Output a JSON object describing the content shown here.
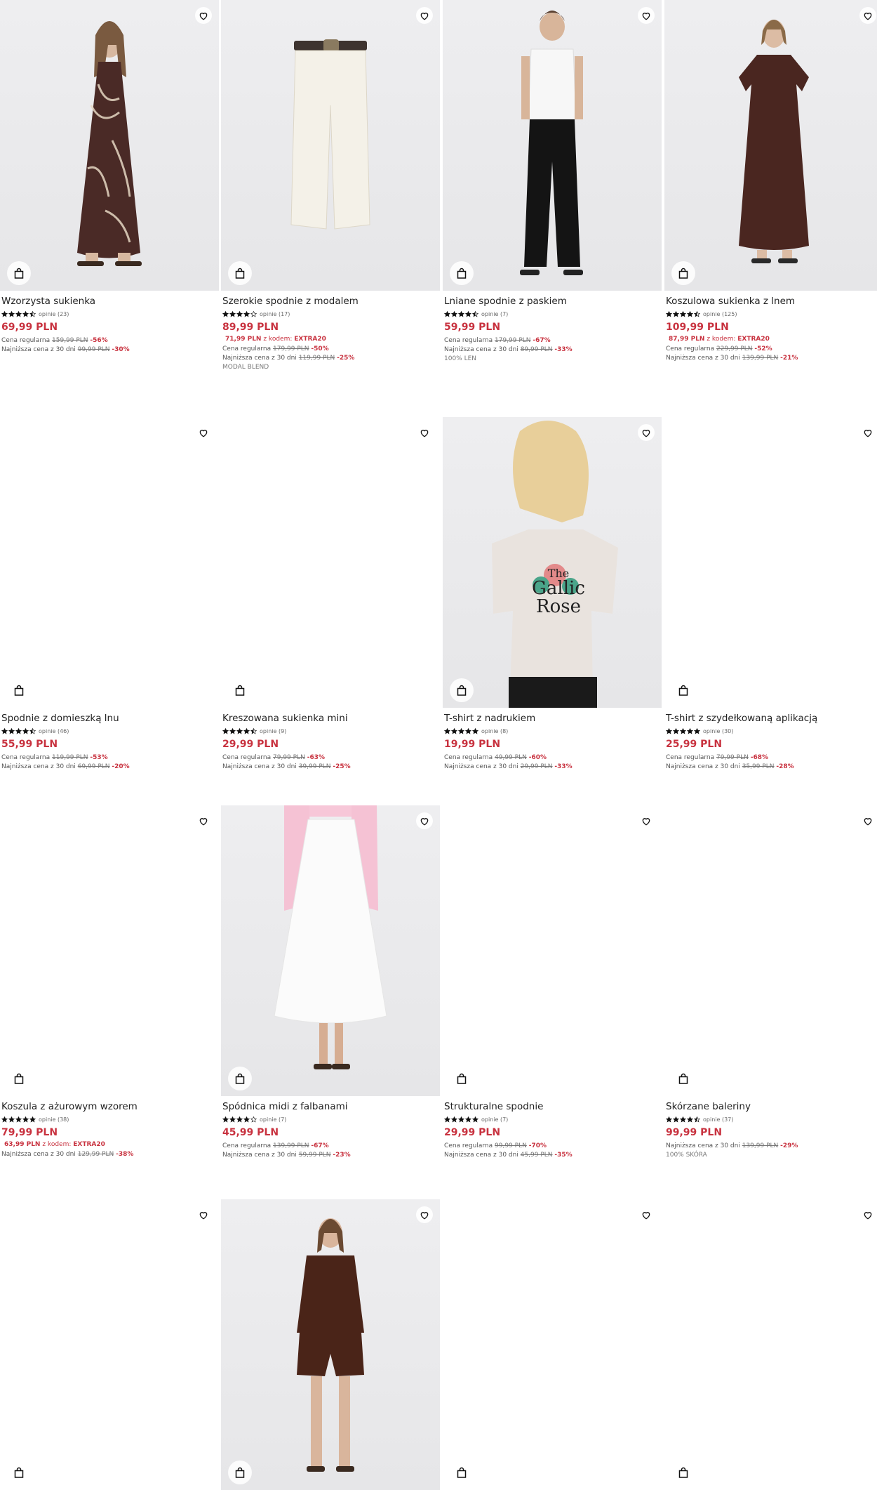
{
  "colors": {
    "accent": "#c8323f",
    "text": "#222222",
    "muted": "#777777"
  },
  "labels": {
    "regular": "Cena regularna",
    "lowest": "Najniższa cena z 30 dni",
    "code": "z kodem:"
  },
  "products": [
    {
      "title": "Wzorzysta sukienka",
      "rating": 4.5,
      "reviews": "opinie (23)",
      "price": "69,99 PLN",
      "regular": {
        "old": "159,99 PLN",
        "disc": "-56%"
      },
      "lowest": {
        "old": "99,99 PLN",
        "disc": "-30%"
      },
      "photo": "dress-print"
    },
    {
      "title": "Szerokie spodnie z modalem",
      "rating": 4,
      "reviews": "opinie (17)",
      "price": "89,99 PLN",
      "promo": {
        "price": "71,99 PLN",
        "label": "z kodem:",
        "code": "EXTRA20"
      },
      "regular": {
        "old": "179,99 PLN",
        "disc": "-50%"
      },
      "lowest": {
        "old": "119,99 PLN",
        "disc": "-25%"
      },
      "material": "MODAL BLEND",
      "photo": "cream-trousers"
    },
    {
      "title": "Lniane spodnie z paskiem",
      "rating": 4.5,
      "reviews": "opinie (7)",
      "price": "59,99 PLN",
      "regular": {
        "old": "179,99 PLN",
        "disc": "-67%"
      },
      "lowest": {
        "old": "89,99 PLN",
        "disc": "-33%"
      },
      "material": "100% LEN",
      "photo": "black-trousers"
    },
    {
      "title": "Koszulowa sukienka z lnem",
      "rating": 4.5,
      "reviews": "opinie (125)",
      "price": "109,99 PLN",
      "promo": {
        "price": "87,99 PLN",
        "label": "z kodem:",
        "code": "EXTRA20"
      },
      "regular": {
        "old": "229,99 PLN",
        "disc": "-52%"
      },
      "lowest": {
        "old": "139,99 PLN",
        "disc": "-21%"
      },
      "photo": "brown-dress"
    },
    {
      "title": "Spodnie z domieszką lnu",
      "rating": 4.5,
      "reviews": "opinie (46)",
      "price": "55,99 PLN",
      "regular": {
        "old": "119,99 PLN",
        "disc": "-53%"
      },
      "lowest": {
        "old": "69,99 PLN",
        "disc": "-20%"
      },
      "photo": ""
    },
    {
      "title": "Kreszowana sukienka mini",
      "rating": 4.5,
      "reviews": "opinie (9)",
      "price": "29,99 PLN",
      "regular": {
        "old": "79,99 PLN",
        "disc": "-63%"
      },
      "lowest": {
        "old": "39,99 PLN",
        "disc": "-25%"
      },
      "photo": ""
    },
    {
      "title": "T-shirt z nadrukiem",
      "rating": 5,
      "reviews": "opinie (8)",
      "price": "19,99 PLN",
      "regular": {
        "old": "49,99 PLN",
        "disc": "-60%"
      },
      "lowest": {
        "old": "29,99 PLN",
        "disc": "-33%"
      },
      "photo": "tshirt-print",
      "tshirtText": [
        "The",
        "Gallic",
        "Rose"
      ]
    },
    {
      "title": "T-shirt z szydełkowaną aplikacją",
      "rating": 5,
      "reviews": "opinie (30)",
      "price": "25,99 PLN",
      "regular": {
        "old": "79,99 PLN",
        "disc": "-68%"
      },
      "lowest": {
        "old": "35,99 PLN",
        "disc": "-28%"
      },
      "photo": ""
    },
    {
      "title": "Koszula z ażurowym wzorem",
      "rating": 5,
      "reviews": "opinie (38)",
      "price": "79,99 PLN",
      "promo": {
        "price": "63,99 PLN",
        "label": "z kodem:",
        "code": "EXTRA20"
      },
      "lowest": {
        "old": "129,99 PLN",
        "disc": "-38%"
      },
      "photo": ""
    },
    {
      "title": "Spódnica midi z falbanami",
      "rating": 4,
      "reviews": "opinie (7)",
      "price": "45,99 PLN",
      "regular": {
        "old": "139,99 PLN",
        "disc": "-67%"
      },
      "lowest": {
        "old": "59,99 PLN",
        "disc": "-23%"
      },
      "photo": "white-skirt"
    },
    {
      "title": "Strukturalne spodnie",
      "rating": 5,
      "reviews": "opinie (7)",
      "price": "29,99 PLN",
      "regular": {
        "old": "99,99 PLN",
        "disc": "-70%"
      },
      "lowest": {
        "old": "45,99 PLN",
        "disc": "-35%"
      },
      "photo": ""
    },
    {
      "title": "Skórzane baleriny",
      "rating": 4.5,
      "reviews": "opinie (37)",
      "price": "99,99 PLN",
      "lowest": {
        "old": "139,99 PLN",
        "disc": "-29%"
      },
      "material": "100% SKÓRA",
      "photo": ""
    },
    {
      "photo": ""
    },
    {
      "photo": "brown-set"
    },
    {
      "photo": ""
    },
    {
      "photo": ""
    }
  ]
}
